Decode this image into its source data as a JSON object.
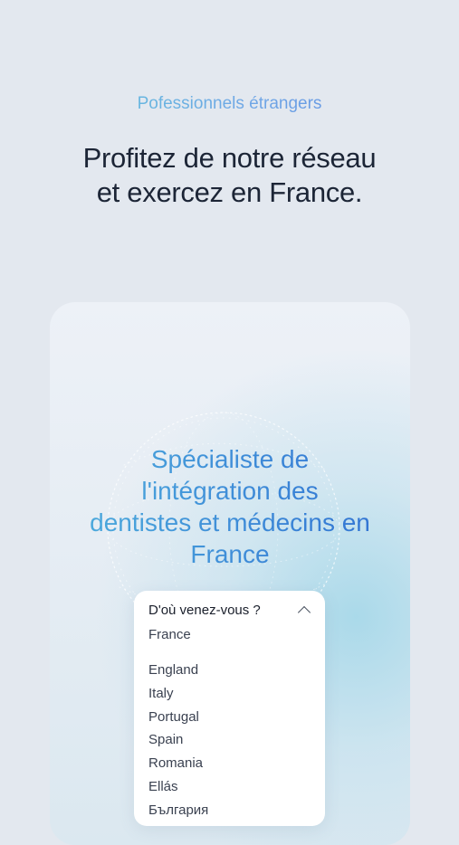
{
  "hero": {
    "eyebrow": "Pofessionnels étrangers",
    "title_line1": "Profitez de notre réseau",
    "title_line2": "et exercez en France."
  },
  "card": {
    "heading_line1": "Spécialiste de",
    "heading_line2": "l'intégration des",
    "heading_line3": "dentistes et médecins en",
    "heading_line4": "France"
  },
  "country_select": {
    "label": "D'où venez-vous ?",
    "selected": "France",
    "options": [
      "England",
      "Italy",
      "Portugal",
      "Spain",
      "Romania",
      "Ellás",
      "България"
    ],
    "icon": "chevron-up-icon"
  },
  "colors": {
    "background": "#e3e8ef",
    "title": "#1c2536",
    "accent_start": "#5fc9d8",
    "accent_end": "#2f6fd2"
  }
}
